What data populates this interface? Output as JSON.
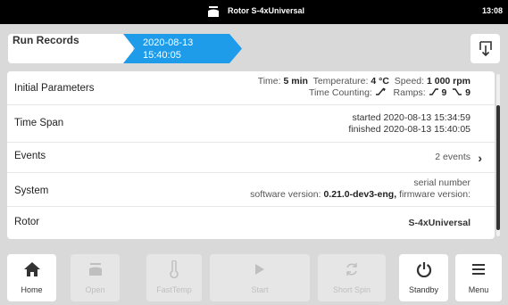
{
  "statusbar": {
    "title": "Rotor S-4xUniversal",
    "time": "13:08"
  },
  "breadcrumb": {
    "first": "Run Records",
    "active_line1": "2020-08-13",
    "active_line2": "15:40:05"
  },
  "rows": {
    "initial": {
      "label": "Initial Parameters",
      "time_label": "Time:",
      "time_value": "5 min",
      "temp_label": "Temperature:",
      "temp_value": "4 °C",
      "speed_label": "Speed:",
      "speed_value": "1 000 rpm",
      "counting_label": "Time Counting:",
      "ramps_label": "Ramps:",
      "ramp_up": "9",
      "ramp_down": "9"
    },
    "timespan": {
      "label": "Time Span",
      "started": "started 2020-08-13 15:34:59",
      "finished": "finished 2020-08-13 15:40:05"
    },
    "events": {
      "label": "Events",
      "value": "2 events"
    },
    "system": {
      "label": "System",
      "serial_label": "serial number",
      "software_label": "software version:",
      "software_value": "0.21.0-dev3-eng,",
      "firmware_label": "firmware version:"
    },
    "rotor": {
      "label": "Rotor",
      "value": "S-4xUniversal"
    }
  },
  "bottom": {
    "home": "Home",
    "open": "Open",
    "fasttemp": "FastTemp",
    "start": "Start",
    "shortspin": "Short Spin",
    "standby": "Standby",
    "menu": "Menu"
  }
}
